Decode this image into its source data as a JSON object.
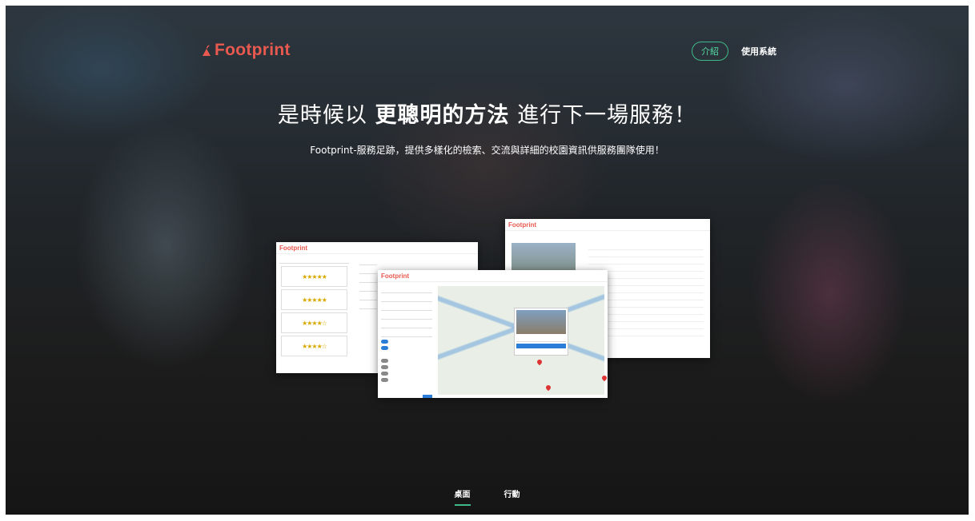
{
  "brand": {
    "name": "Footprint",
    "color": "#e8594f"
  },
  "nav": {
    "intro_label": "介紹",
    "system_label": "使用系統"
  },
  "hero": {
    "headline_pre": "是時候以 ",
    "headline_bold": "更聰明的方法",
    "headline_post": " 進行下一場服務！",
    "subline": "Footprint-服務足跡，提供多樣化的檢索、交流與詳細的校園資訊供服務團隊使用！"
  },
  "tabs": [
    {
      "label": "桌面",
      "active": true
    },
    {
      "label": "行動",
      "active": false
    }
  ],
  "accent": "#3fb98a"
}
